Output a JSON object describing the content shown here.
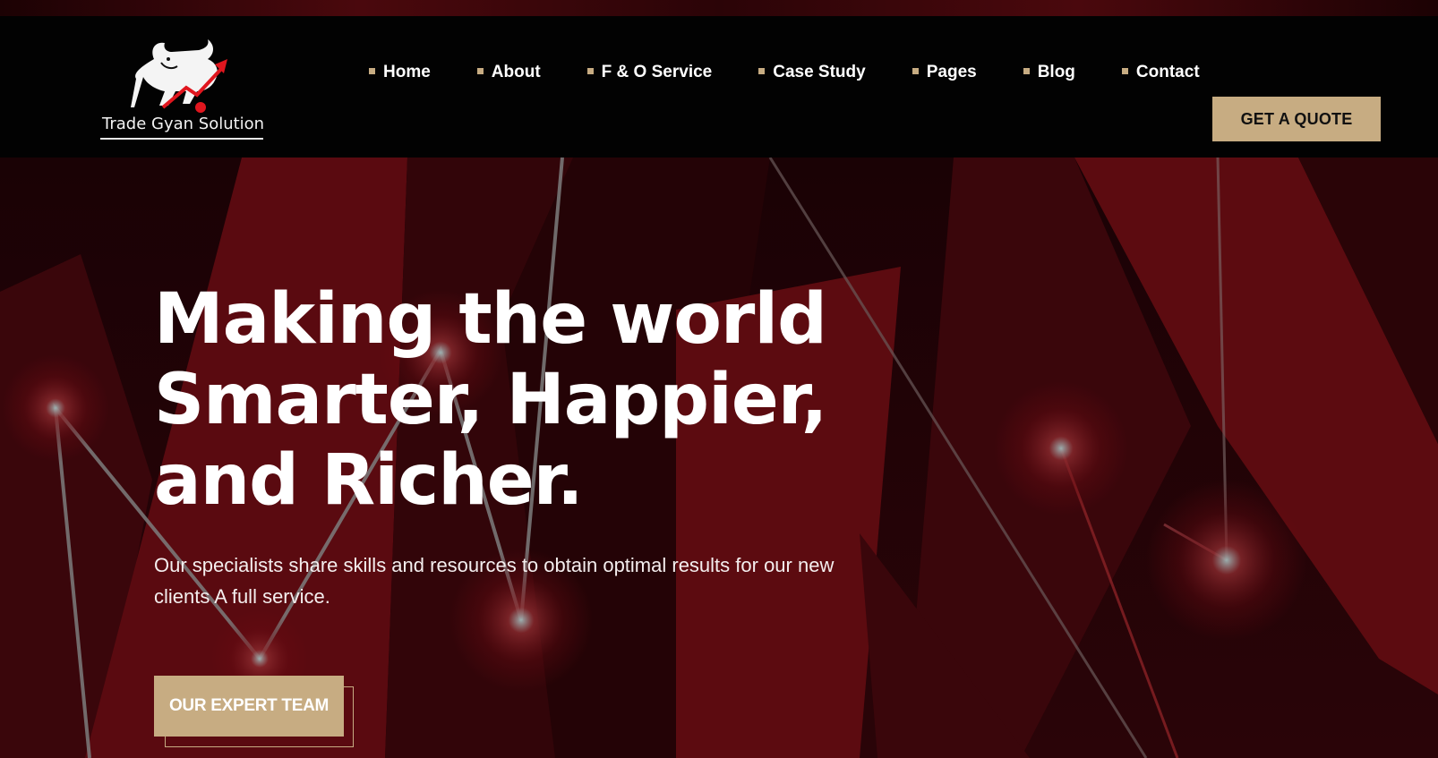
{
  "brand": {
    "logo_text": "Trade Gyan Solution",
    "accent_color": "#c7ac82",
    "header_bg": "#020202",
    "hero_red": "#5c0b10"
  },
  "nav": {
    "items": [
      {
        "label": "Home"
      },
      {
        "label": "About"
      },
      {
        "label": "F & O Service"
      },
      {
        "label": "Case Study"
      },
      {
        "label": "Pages"
      },
      {
        "label": "Blog"
      },
      {
        "label": "Contact"
      }
    ],
    "cta_label": "GET A QUOTE"
  },
  "hero": {
    "title_lines": [
      "Making the world",
      "Smarter, Happier,",
      "and Richer."
    ],
    "subtitle": "Our specialists share skills and resources to obtain optimal results for our new clients A full service.",
    "cta_label": "OUR EXPERT TEAM"
  },
  "icons": {
    "logo_mark": "bull-chart-icon",
    "nav_bullet": "square-bullet-icon"
  }
}
